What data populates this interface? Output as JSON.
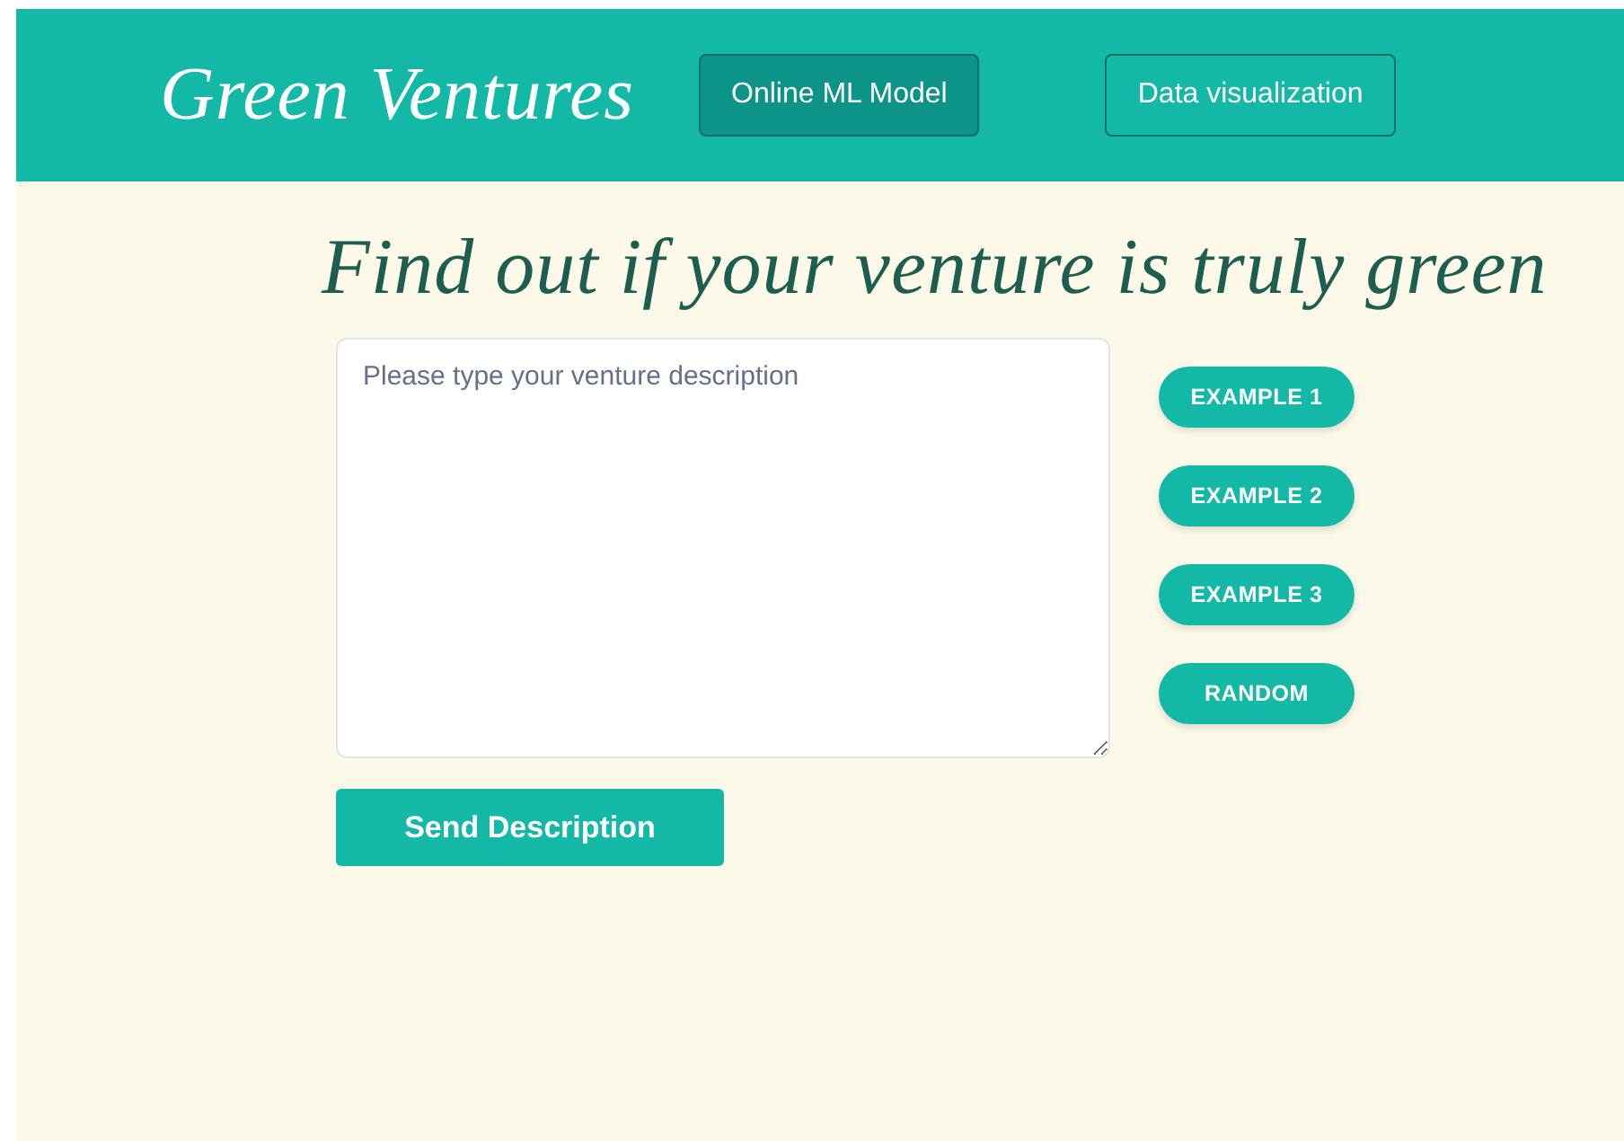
{
  "header": {
    "logo": "Green Ventures",
    "nav": [
      {
        "label": "Online ML Model",
        "selected": true
      },
      {
        "label": "Data visualization",
        "selected": false
      }
    ]
  },
  "heading": "Find out if your venture is truly green",
  "description": {
    "placeholder": "Please type your venture description"
  },
  "examples": [
    "EXAMPLE 1",
    "EXAMPLE 2",
    "EXAMPLE 3",
    "RANDOM"
  ],
  "submit": "Send Description"
}
